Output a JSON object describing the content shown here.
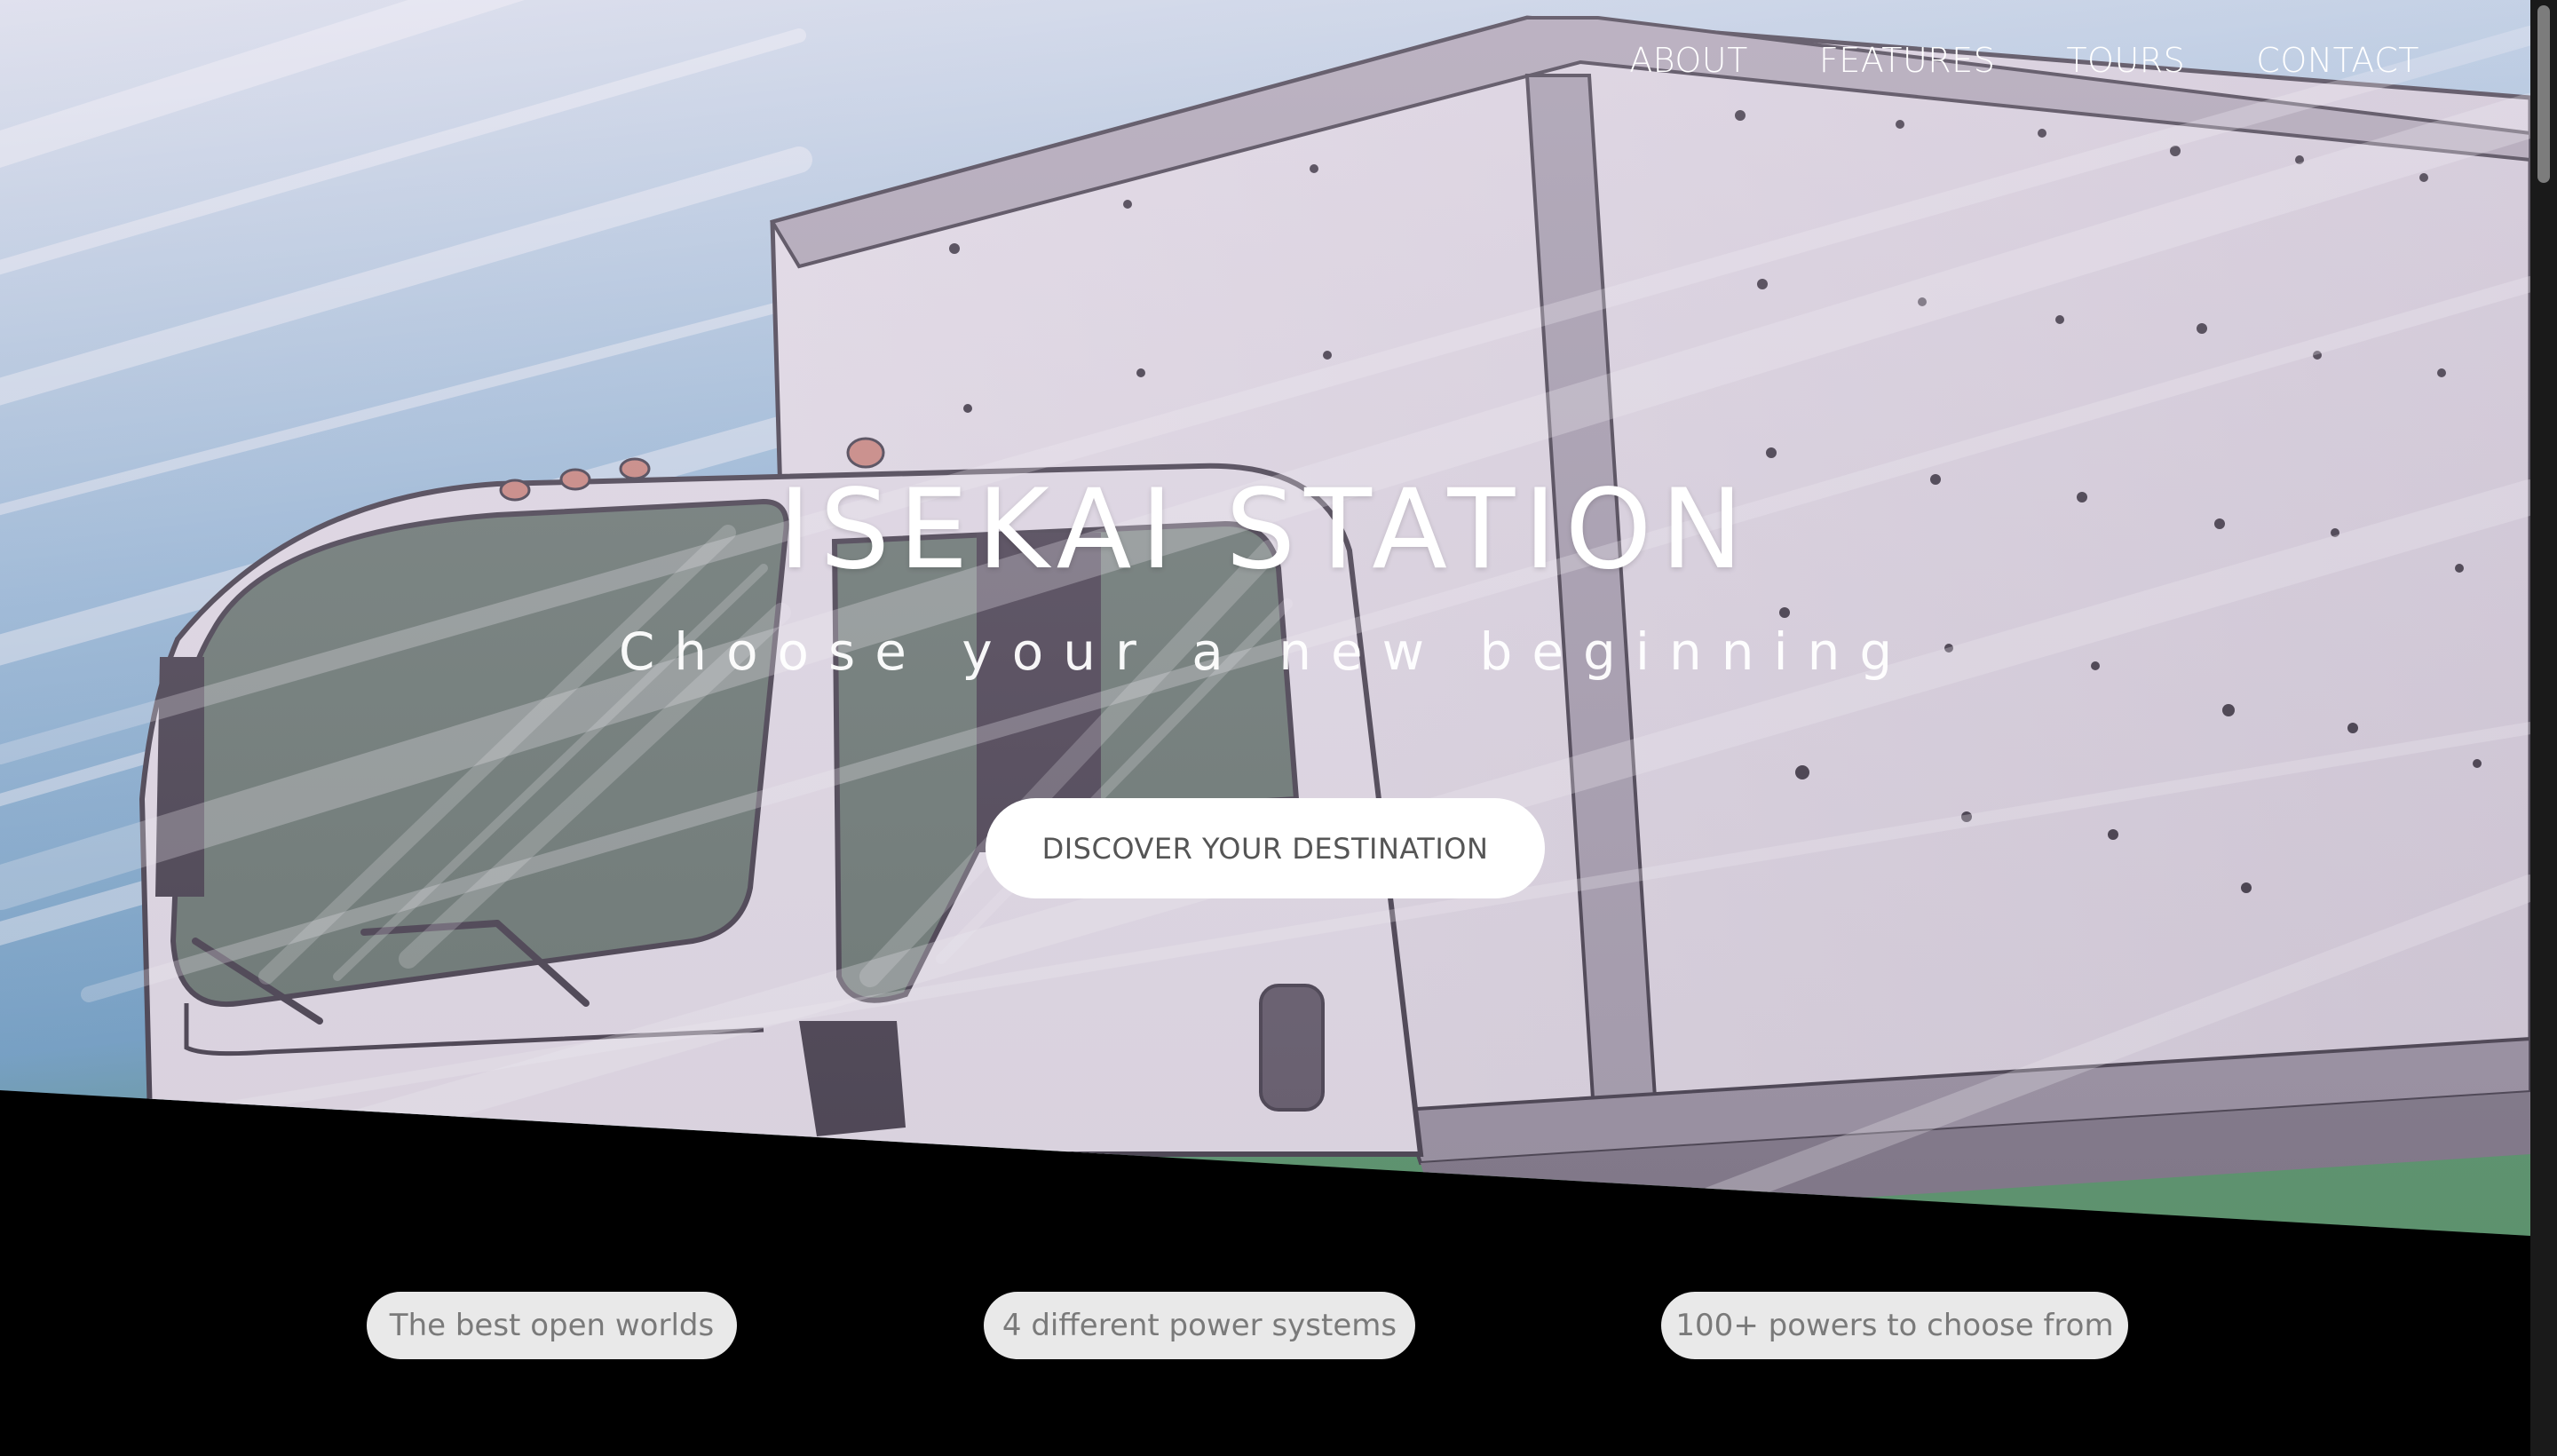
{
  "nav": {
    "items": [
      {
        "label": "ABOUT"
      },
      {
        "label": "FEATURES"
      },
      {
        "label": "TOURS"
      },
      {
        "label": "CONTACT"
      }
    ]
  },
  "hero": {
    "title": "ISEKAI STATION",
    "subtitle": "Choose your a new beginning",
    "cta_label": "DISCOVER YOUR DESTINATION",
    "image_icon": "truck-illustration"
  },
  "features": {
    "items": [
      {
        "label": "The best open worlds"
      },
      {
        "label": "4 different power systems"
      },
      {
        "label": "100+ powers to choose from"
      }
    ]
  },
  "colors": {
    "page_background": "#000000",
    "sky": "#8fb8d6",
    "truck_body": "#d9d2dc",
    "overlay_tint": "#d8cde0",
    "pill_background": "#e9e9e9",
    "pill_text": "#7a7a7a",
    "cta_background": "#ffffff",
    "cta_text": "#555555"
  }
}
